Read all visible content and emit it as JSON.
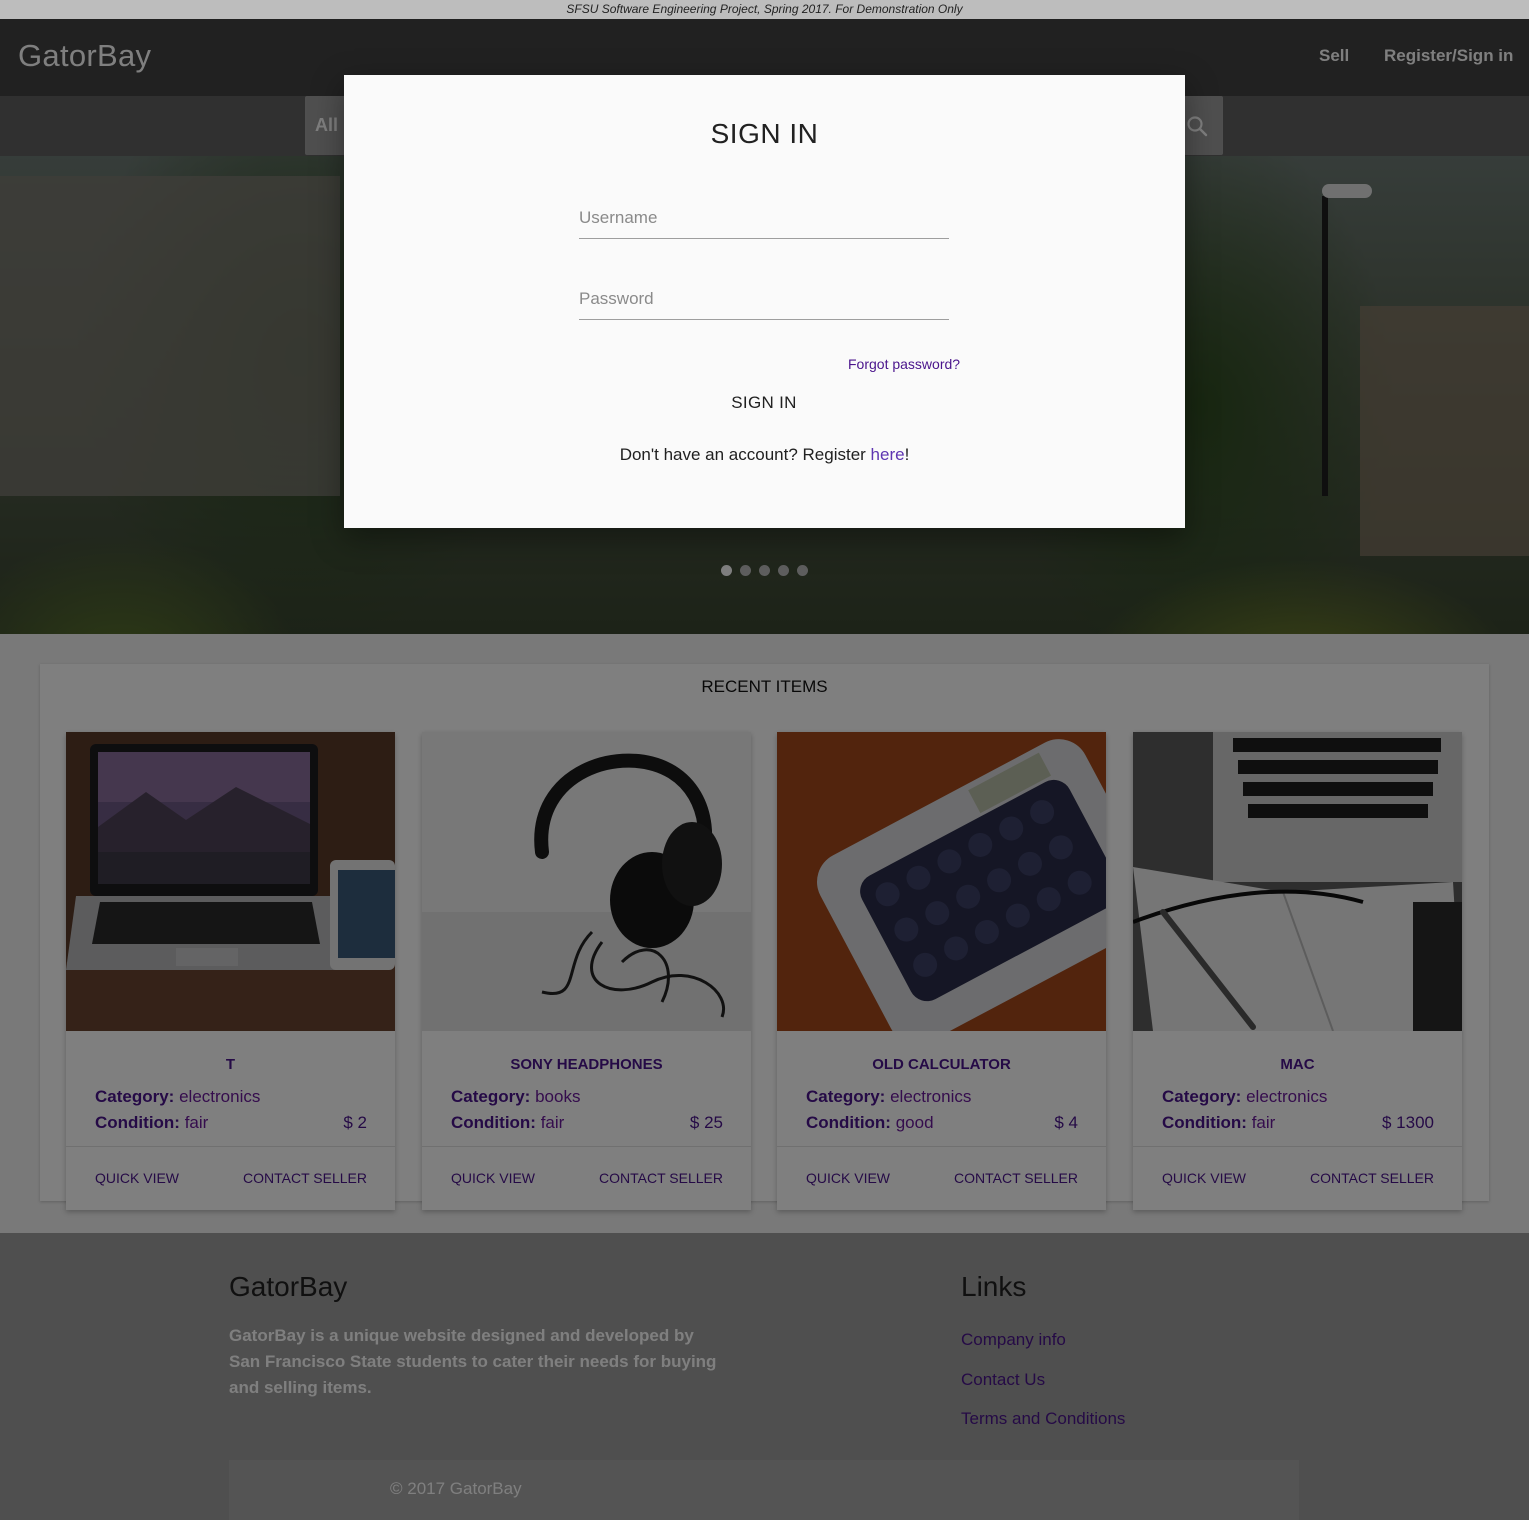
{
  "banner": {
    "text": "SFSU Software Engineering Project, Spring 2017. For Demonstration Only"
  },
  "navbar": {
    "brand": "GatorBay",
    "sell": "Sell",
    "register_signin": "Register/Sign in"
  },
  "search": {
    "category_visible": "All",
    "icon": "search-icon"
  },
  "carousel": {
    "slide_count": 5,
    "active_index": 0
  },
  "recent": {
    "title": "RECENT ITEMS",
    "category_label": "Category:",
    "condition_label": "Condition:",
    "quick_view": "QUICK VIEW",
    "contact_seller": "CONTACT SELLER",
    "items": [
      {
        "title": "T",
        "category": "electronics",
        "condition": "fair",
        "price": "$ 2"
      },
      {
        "title": "SONY HEADPHONES",
        "category": "books",
        "condition": "fair",
        "price": "$ 25"
      },
      {
        "title": "OLD CALCULATOR",
        "category": "electronics",
        "condition": "good",
        "price": "$ 4"
      },
      {
        "title": "MAC",
        "category": "electronics",
        "condition": "fair",
        "price": "$ 1300"
      }
    ]
  },
  "footer": {
    "brand": "GatorBay",
    "description": "GatorBay is a unique website designed and developed by San Francisco State students to cater their needs for buying and selling items.",
    "links_title": "Links",
    "links": [
      "Company info",
      "Contact Us",
      "Terms and Conditions"
    ],
    "copyright": "© 2017 GatorBay"
  },
  "modal": {
    "title": "SIGN IN",
    "username_placeholder": "Username",
    "password_placeholder": "Password",
    "forgot": "Forgot password?",
    "signin_button": "SIGN IN",
    "register_prefix": "Don't have an account? Register ",
    "register_link": "here",
    "register_suffix": "!"
  },
  "colors": {
    "accent": "#4a148c",
    "link": "#5e35b1",
    "navbar": "#424242"
  }
}
